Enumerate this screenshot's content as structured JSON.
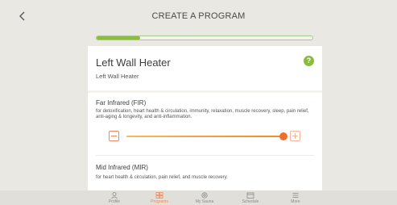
{
  "header": {
    "title": "CREATE A PROGRAM",
    "back_icon": "chevron-left-icon"
  },
  "progress": {
    "fraction": 0.2,
    "color": "#8bbd3c"
  },
  "heater": {
    "title": "Left Wall Heater",
    "subtitle": "Left Wall Heater",
    "help_icon": "?"
  },
  "fir": {
    "title": "Far Infrared (FIR)",
    "description": "for detoxification, heart health & circulation, immunity, relaxation, muscle recovery, sleep, pain relief, anti-aging & longevity, and anti-inflammation.",
    "level": 1.0
  },
  "mir": {
    "title": "Mid Infrared (MIR)",
    "description": "for heart health & circulation, pain relief, and muscle recovery."
  },
  "tabs": [
    {
      "label": "Profile",
      "icon": "person-icon",
      "active": false
    },
    {
      "label": "Programs",
      "icon": "programs-grid-icon",
      "active": true
    },
    {
      "label": "My Sauna",
      "icon": "sauna-icon",
      "active": false
    },
    {
      "label": "Schedule",
      "icon": "calendar-icon",
      "active": false
    },
    {
      "label": "More",
      "icon": "menu-icon",
      "active": false
    }
  ],
  "colors": {
    "accent": "#f08a5a",
    "green": "#8bbd3c",
    "background": "#e9e8e3"
  }
}
